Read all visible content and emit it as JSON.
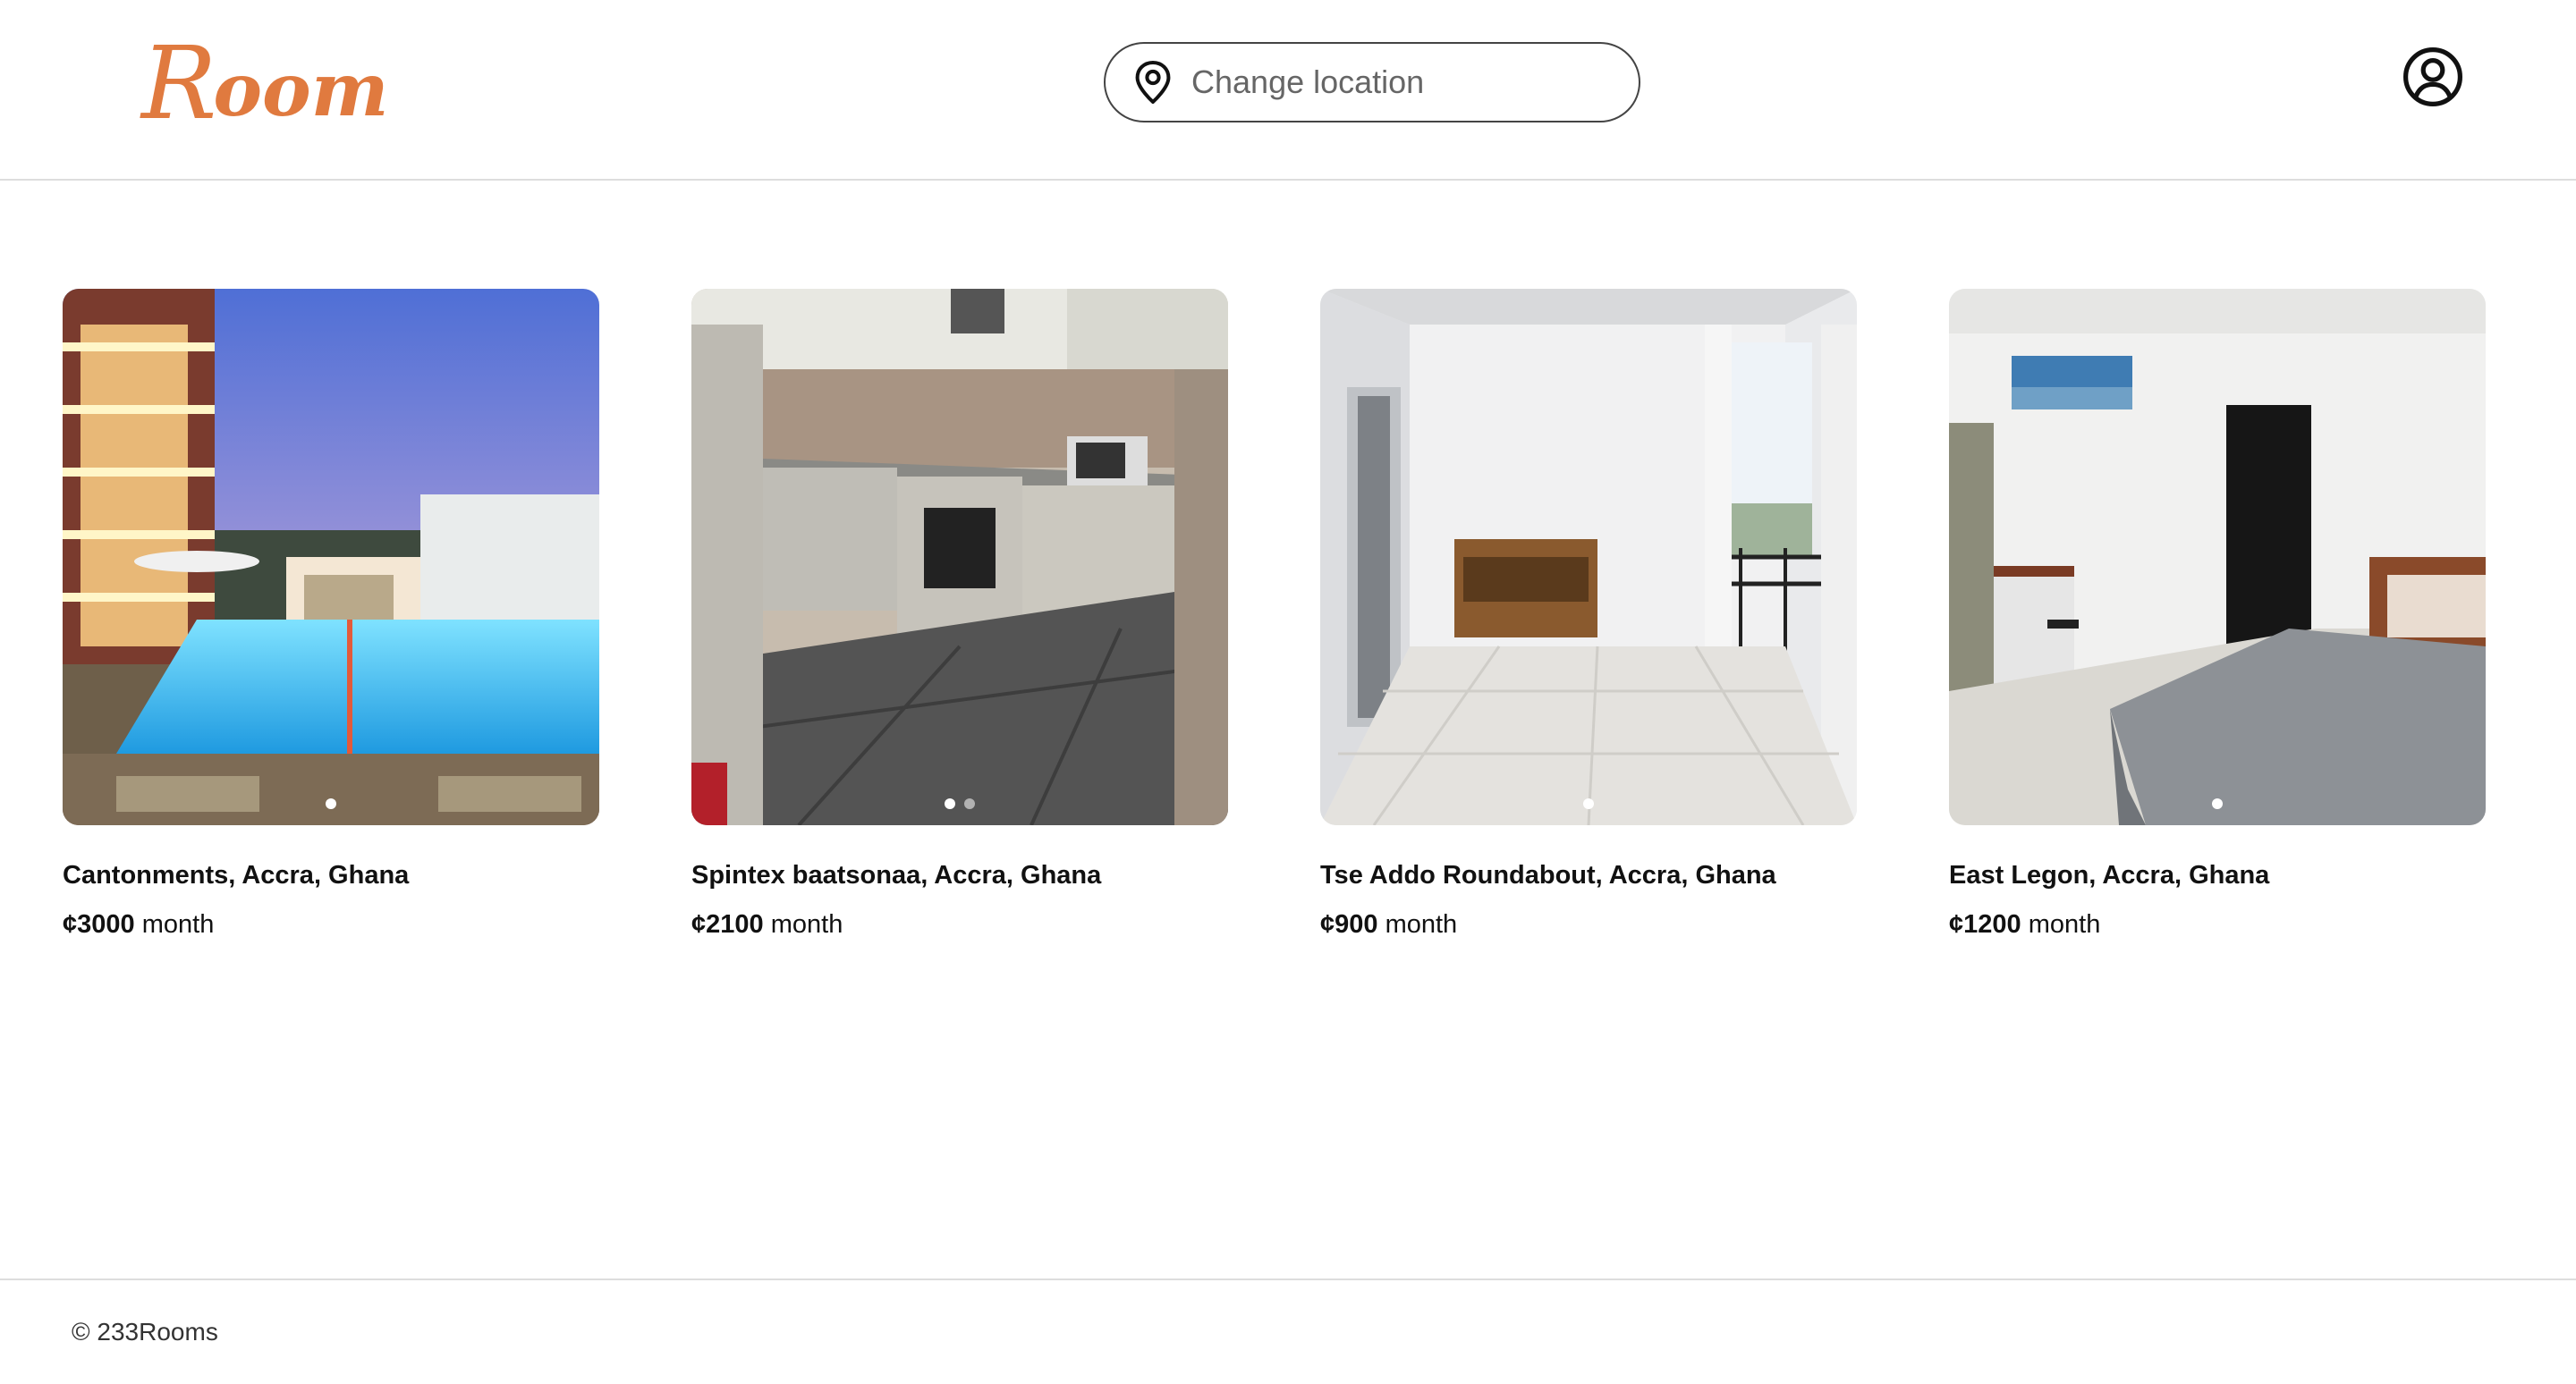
{
  "header": {
    "logo_cap": "R",
    "logo_rest": "oom",
    "search": {
      "placeholder": "Change location",
      "icon": "location-pin-icon"
    },
    "account_icon": "user-circle-icon"
  },
  "listings": [
    {
      "location": "Cantonments, Accra, Ghana",
      "price": "¢3000",
      "unit": "month",
      "photo": "pool"
    },
    {
      "location": "Spintex baatsonaa, Accra, Ghana",
      "price": "¢2100",
      "unit": "month",
      "photo": "kitchen"
    },
    {
      "location": "Tse Addo Roundabout, Accra, Ghana",
      "price": "¢900",
      "unit": "month",
      "photo": "balcony"
    },
    {
      "location": "East Legon, Accra, Ghana",
      "price": "¢1200",
      "unit": "month",
      "photo": "bedroom"
    }
  ],
  "footer": {
    "copyright": "© 233Rooms"
  },
  "colors": {
    "brand": "#e07a3f",
    "border": "#dddddd"
  }
}
